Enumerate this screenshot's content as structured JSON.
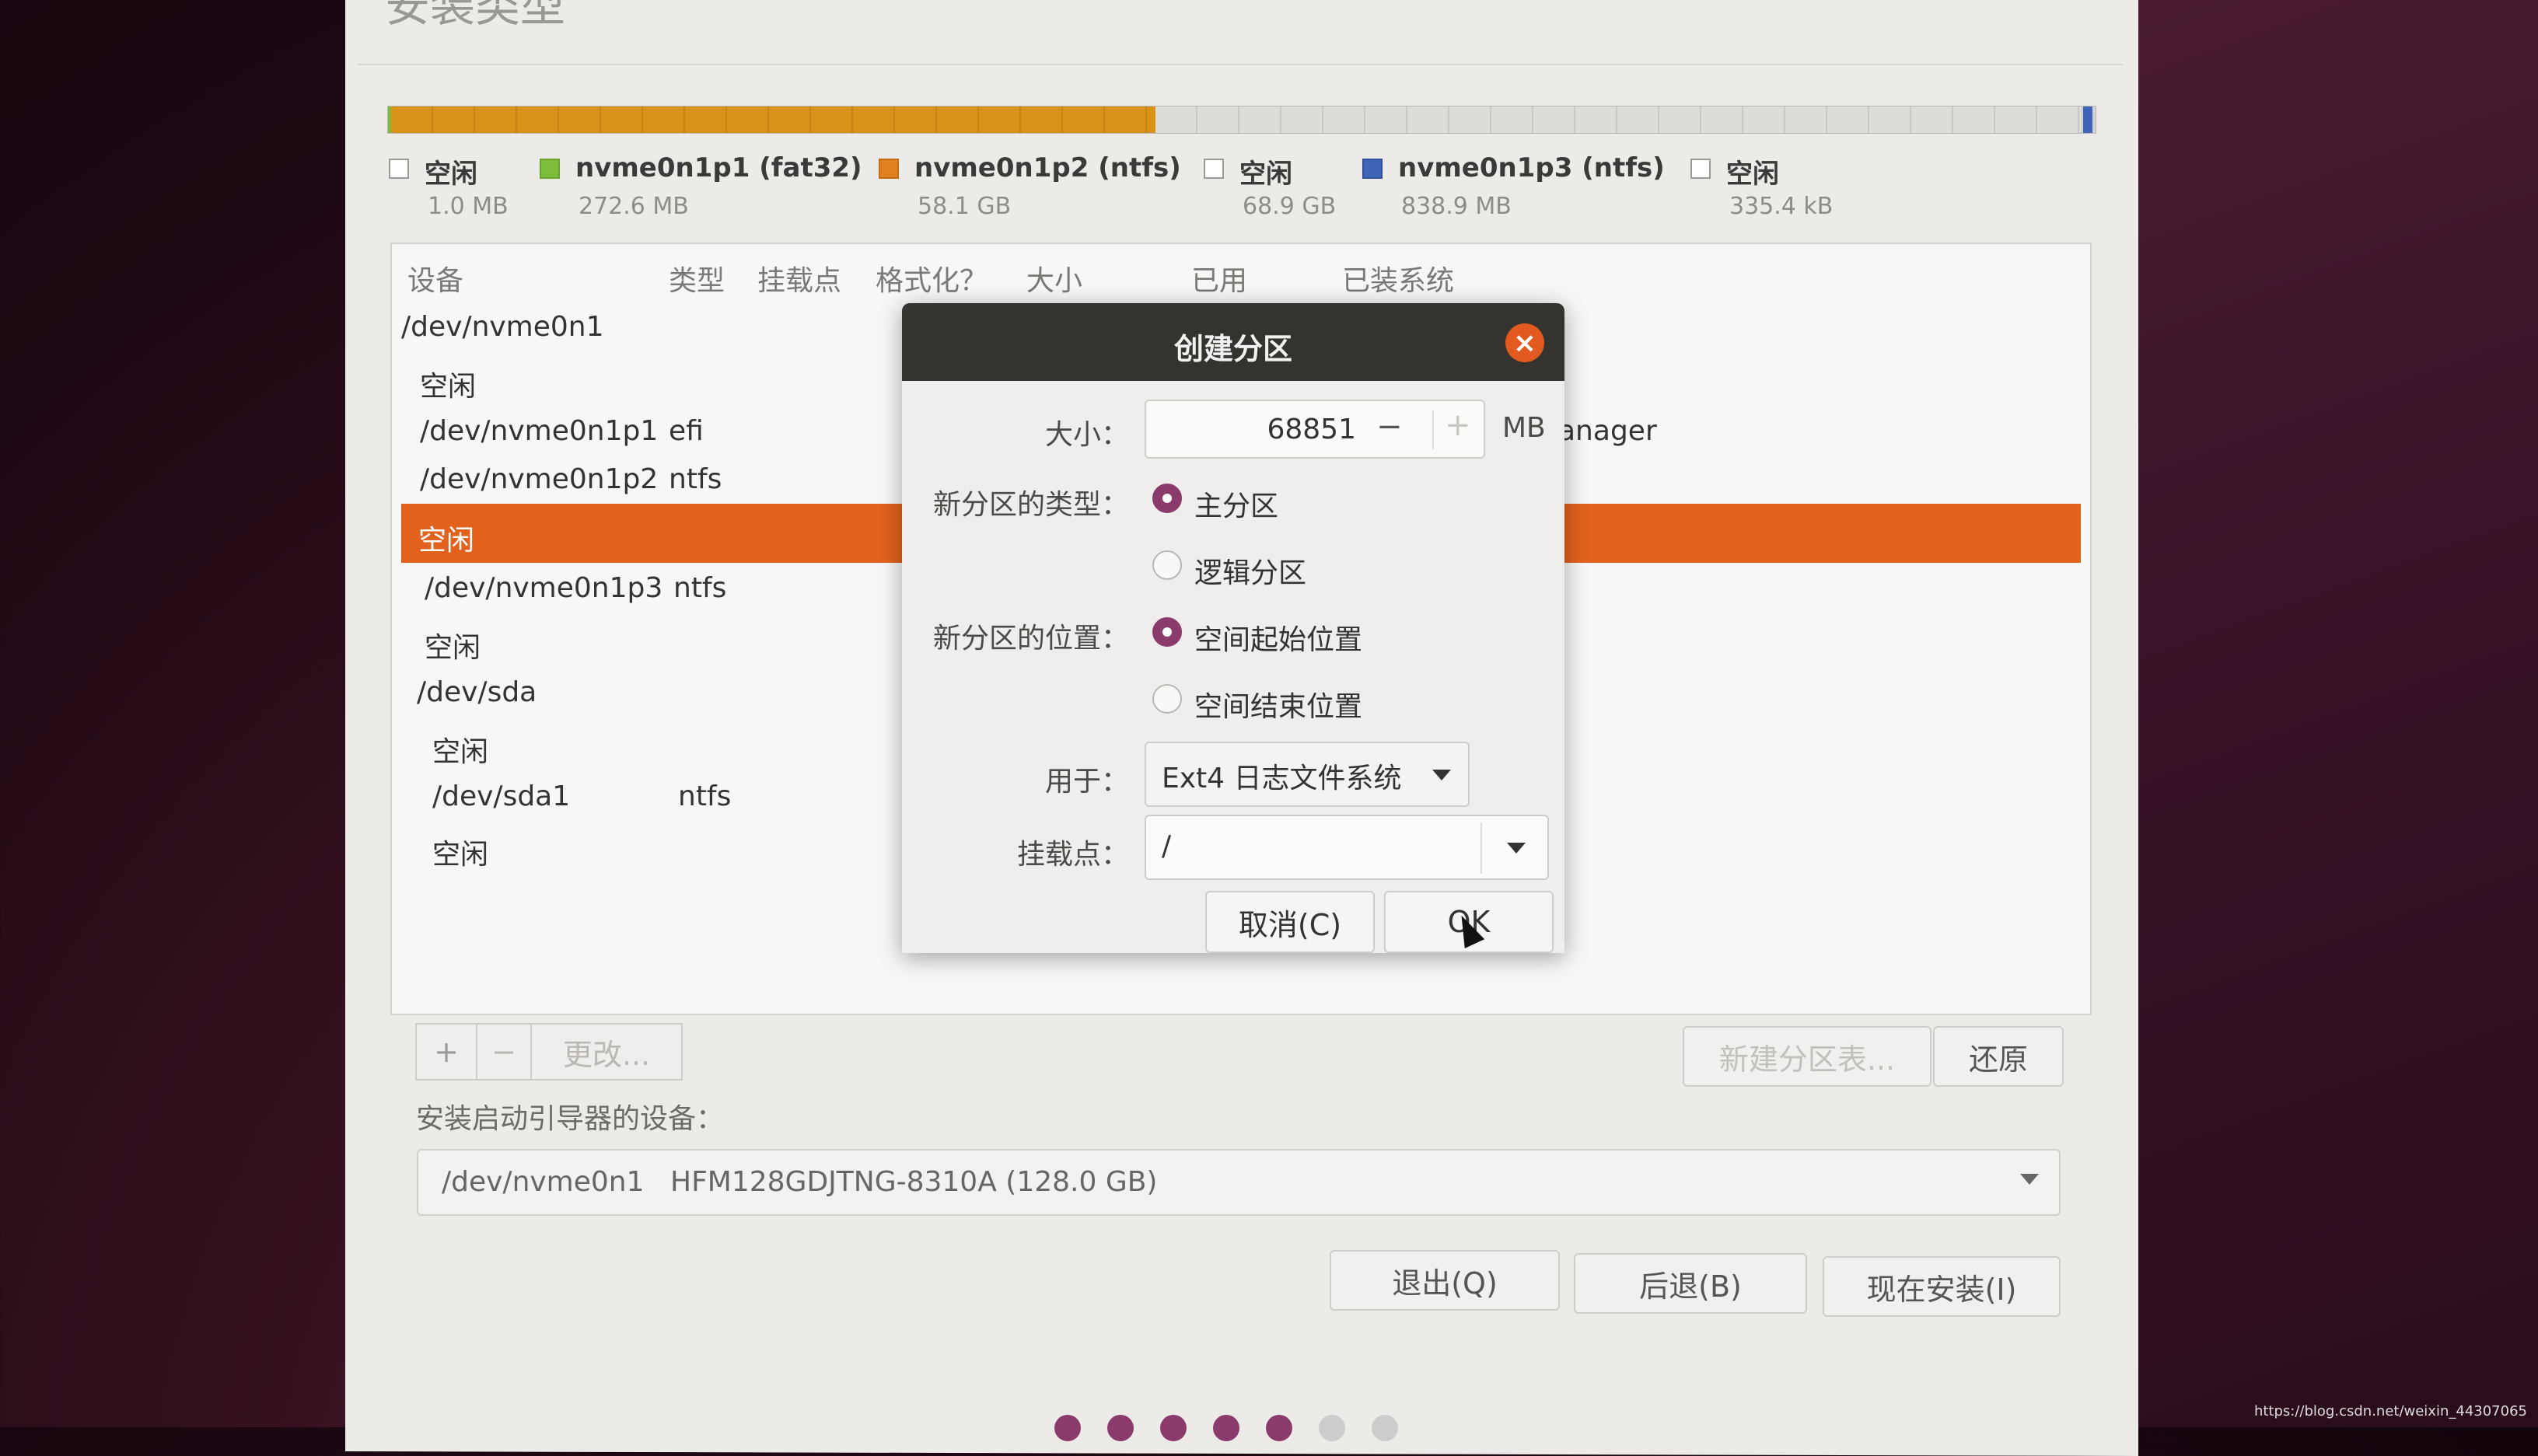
{
  "window": {
    "title": "安装类型"
  },
  "legend": [
    {
      "name": "空闲",
      "size": "1.0 MB",
      "color": "#ffffff"
    },
    {
      "name": "nvme0n1p1 (fat32)",
      "size": "272.6 MB",
      "color": "#7dbd3a"
    },
    {
      "name": "nvme0n1p2 (ntfs)",
      "size": "58.1 GB",
      "color": "#e1811f"
    },
    {
      "name": "空闲",
      "size": "68.9 GB",
      "color": "#ffffff"
    },
    {
      "name": "nvme0n1p3 (ntfs)",
      "size": "838.9 MB",
      "color": "#3f64b8"
    },
    {
      "name": "空闲",
      "size": "335.4 kB",
      "color": "#ffffff"
    }
  ],
  "table": {
    "headers": [
      "设备",
      "类型",
      "挂载点",
      "格式化？",
      "大小",
      "已用",
      "已装系统"
    ],
    "rows": [
      {
        "device": "/dev/nvme0n1",
        "type": "",
        "extra": ""
      },
      {
        "device": "空闲",
        "type": "",
        "extra": ""
      },
      {
        "device": "/dev/nvme0n1p1",
        "type": "efi",
        "extra": "anager"
      },
      {
        "device": "/dev/nvme0n1p2",
        "type": "ntfs",
        "extra": ""
      },
      {
        "device": "空闲",
        "type": "",
        "extra": "",
        "selected": true
      },
      {
        "device": "/dev/nvme0n1p3",
        "type": "ntfs",
        "extra": ""
      },
      {
        "device": "空闲",
        "type": "",
        "extra": ""
      },
      {
        "device": "/dev/sda",
        "type": "",
        "extra": ""
      },
      {
        "device": "空闲",
        "type": "",
        "extra": ""
      },
      {
        "device": "/dev/sda1",
        "type": "ntfs",
        "extra": ""
      },
      {
        "device": "空闲",
        "type": "",
        "extra": ""
      }
    ]
  },
  "toolbar": {
    "add": "+",
    "remove": "−",
    "change": "更改..."
  },
  "actions": {
    "new_table": "新建分区表...",
    "revert": "还原"
  },
  "boot": {
    "label": "安装启动引导器的设备：",
    "device": "/dev/nvme0n1",
    "name": "HFM128GDJTNG-8310A (128.0 GB)"
  },
  "nav": {
    "quit": "退出(Q)",
    "back": "后退(B)",
    "install": "现在安装(I)"
  },
  "dialog": {
    "title": "创建分区",
    "close": "×",
    "size_label": "大小：",
    "size_value": "68851",
    "size_minus": "−",
    "size_plus": "+",
    "size_unit": "MB",
    "type_label": "新分区的类型：",
    "type_primary": "主分区",
    "type_logical": "逻辑分区",
    "type_selected": "主分区",
    "location_label": "新分区的位置：",
    "location_start": "空间起始位置",
    "location_end": "空间结束位置",
    "location_selected": "空间起始位置",
    "use_label": "用于：",
    "use_value": "Ext4 日志文件系统",
    "mount_label": "挂载点：",
    "mount_value": "/",
    "cancel": "取消(C)",
    "ok": "OK"
  },
  "progress_dots": {
    "total": 7,
    "active": 5,
    "active_color": "#8a3b6b"
  },
  "watermark": "https://blog.csdn.net/weixin_44307065"
}
